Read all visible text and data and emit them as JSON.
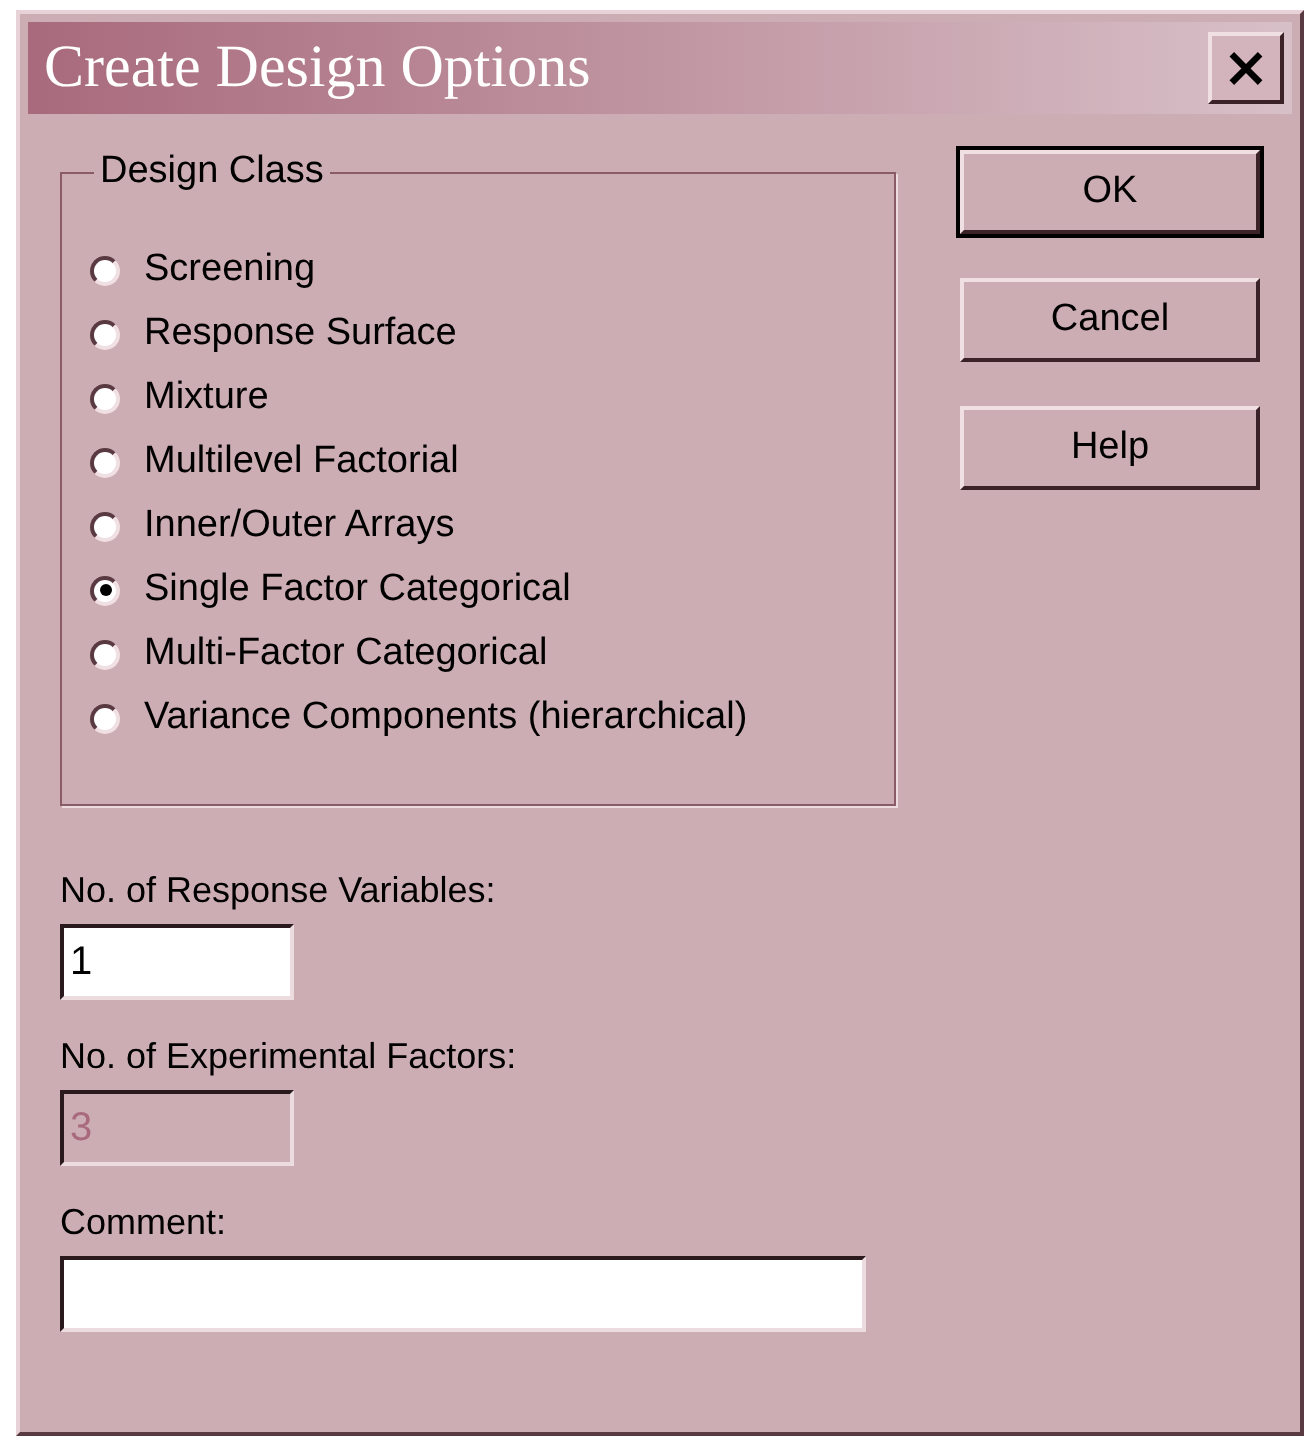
{
  "window": {
    "title": "Create Design Options",
    "close": "×"
  },
  "design_class": {
    "title": "Design Class",
    "options": [
      {
        "label": "Screening",
        "selected": false
      },
      {
        "label": "Response Surface",
        "selected": false
      },
      {
        "label": "Mixture",
        "selected": false
      },
      {
        "label": "Multilevel Factorial",
        "selected": false
      },
      {
        "label": "Inner/Outer Arrays",
        "selected": false
      },
      {
        "label": "Single Factor Categorical",
        "selected": true
      },
      {
        "label": "Multi-Factor Categorical",
        "selected": false
      },
      {
        "label": "Variance Components (hierarchical)",
        "selected": false
      }
    ]
  },
  "buttons": [
    {
      "label": "OK",
      "default": true
    },
    {
      "label": "Cancel",
      "default": false
    },
    {
      "label": "Help",
      "default": false
    }
  ],
  "fields": [
    {
      "label": "No. of Response Variables:",
      "value": "1",
      "disabled": false,
      "kind": "short"
    },
    {
      "label": "No. of Experimental Factors:",
      "value": "3",
      "disabled": true,
      "kind": "short"
    },
    {
      "label": "Comment:",
      "disabled": false,
      "kind": "long"
    }
  ]
}
